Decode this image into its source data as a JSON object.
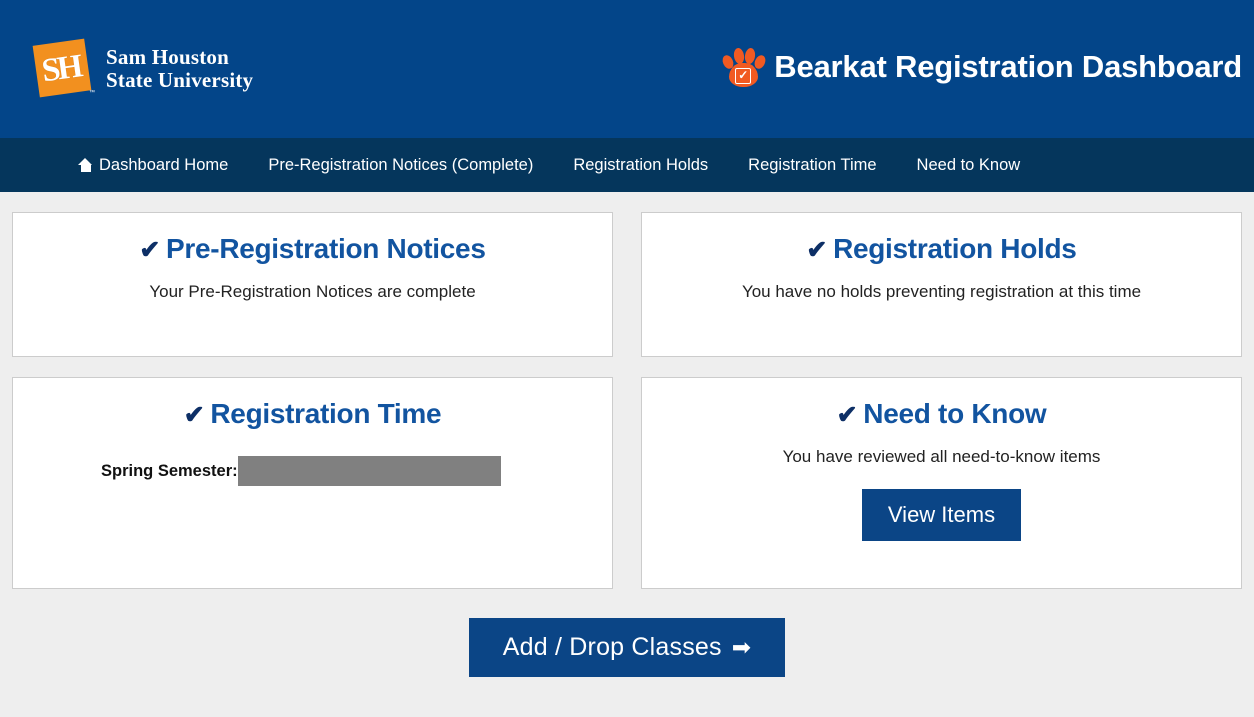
{
  "header": {
    "logo": {
      "monogram": "SH",
      "trademark": "™",
      "line1": "Sam Houston",
      "line2": "State University",
      "icon_name": "shsu-logo",
      "square_color": "#f2901f"
    },
    "paw_icon_name": "paw-check-icon",
    "paw_color": "#f15a22",
    "title": "Bearkat Registration Dashboard",
    "background_color": "#034589"
  },
  "nav": {
    "background_color": "#05365c",
    "items": [
      {
        "label": "Dashboard Home",
        "icon": "home-icon"
      },
      {
        "label": "Pre-Registration Notices (Complete)",
        "icon": ""
      },
      {
        "label": "Registration Holds",
        "icon": ""
      },
      {
        "label": "Registration Time",
        "icon": ""
      },
      {
        "label": "Need to Know",
        "icon": ""
      }
    ]
  },
  "cards": {
    "pre_registration": {
      "check": "✔",
      "title": "Pre-Registration Notices",
      "text": "Your Pre-Registration Notices are complete"
    },
    "registration_holds": {
      "check": "✔",
      "title": "Registration Holds",
      "text": "You have no holds preventing registration at this time"
    },
    "registration_time": {
      "check": "✔",
      "title": "Registration Time",
      "semester_label": "Spring Semester:",
      "semester_value": "",
      "redaction_color": "#808080"
    },
    "need_to_know": {
      "check": "✔",
      "title": "Need to Know",
      "text": "You have reviewed all need-to-know items",
      "button_label": "View Items"
    }
  },
  "footer": {
    "add_drop_label": "Add / Drop Classes",
    "arrow": "➡",
    "button_color": "#0b4586"
  },
  "colors": {
    "brand_blue": "#034589",
    "nav_blue": "#05365c",
    "accent_orange": "#f15a22",
    "title_blue": "#1254a0",
    "page_background": "#eeeeee"
  }
}
